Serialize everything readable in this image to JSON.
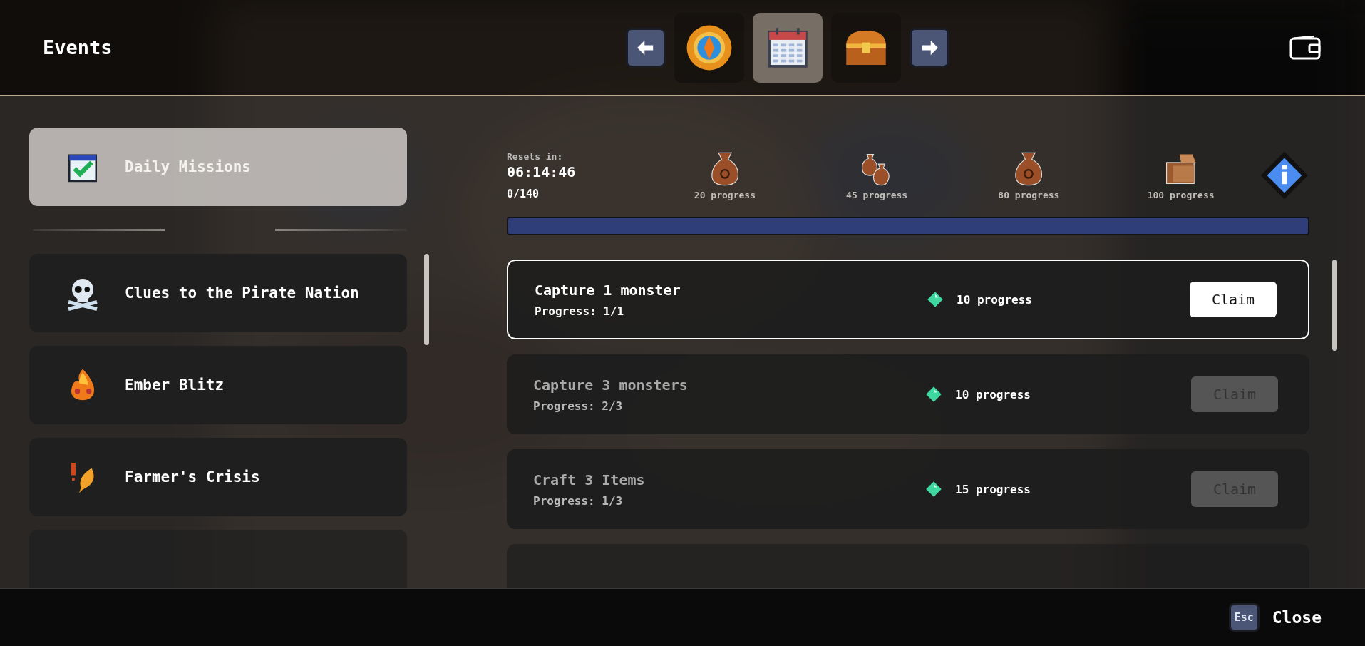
{
  "header": {
    "title": "Events"
  },
  "nav_tabs": [
    {
      "selected": false
    },
    {
      "selected": true
    },
    {
      "selected": false
    }
  ],
  "sidebar": {
    "items": [
      {
        "label": "Daily Missions",
        "selected": true
      },
      {
        "label": "Clues to the Pirate Nation",
        "selected": false
      },
      {
        "label": "Ember Blitz",
        "selected": false
      },
      {
        "label": "Farmer's Crisis",
        "selected": false
      }
    ]
  },
  "rewards": {
    "resets_label": "Resets in:",
    "timer": "06:14:46",
    "points": "0/140",
    "level": 0,
    "milestones": [
      {
        "label": "20 progress"
      },
      {
        "label": "45 progress"
      },
      {
        "label": "80 progress"
      },
      {
        "label": "100 progress"
      }
    ]
  },
  "missions": [
    {
      "title": "Capture 1 monster",
      "progress": "Progress: 1/1",
      "reward": "10 progress",
      "button": "Claim",
      "claimable": true
    },
    {
      "title": "Capture 3 monsters",
      "progress": "Progress: 2/3",
      "reward": "10 progress",
      "button": "Claim",
      "claimable": false
    },
    {
      "title": "Craft 3 Items",
      "progress": "Progress: 1/3",
      "reward": "15 progress",
      "button": "Claim",
      "claimable": false
    }
  ],
  "footer": {
    "key": "Esc",
    "label": "Close"
  }
}
